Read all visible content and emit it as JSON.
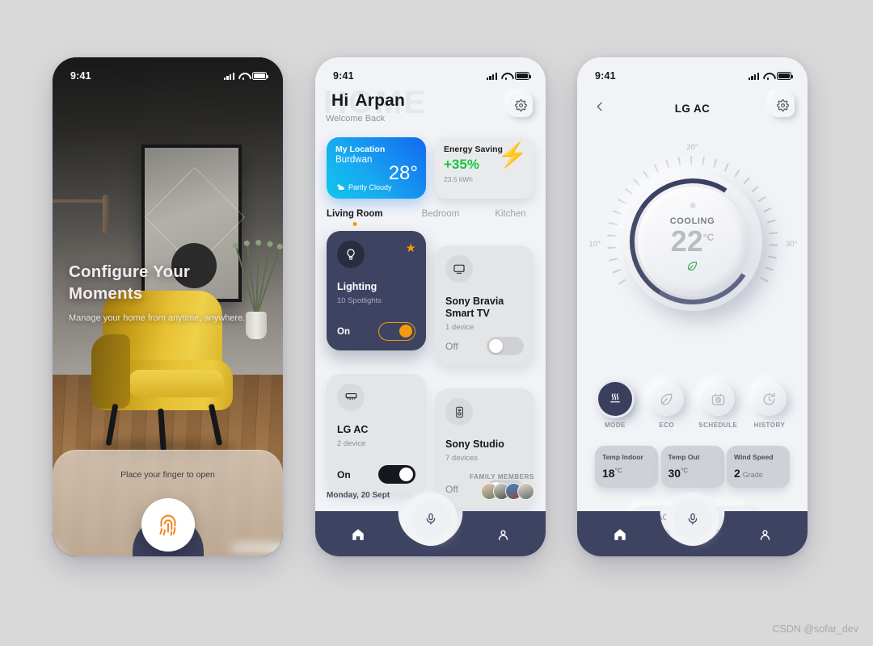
{
  "canvas": {
    "background": "#d9d9d9",
    "watermark": "CSDN @sofar_dev"
  },
  "onboarding": {
    "status": {
      "time": "9:41",
      "signal": "signal-icon",
      "wifi": "wifi-icon",
      "battery": "battery-icon"
    },
    "title": "Configure Your Moments",
    "subtitle": "Manage your home from anytime, anywhere.",
    "unlock_hint": "Place your finger to open",
    "fingerprint_icon": "fingerprint-icon"
  },
  "home": {
    "status": {
      "time": "9:41"
    },
    "watermark": "HOME",
    "greeting_prefix": "Hi",
    "greeting_name": "Arpan",
    "welcome": "Welcome Back",
    "settings_icon": "gear-icon",
    "weather": {
      "label": "My Location",
      "city": "Burdwan",
      "temperature": "28°",
      "condition": "Partly Cloudy",
      "condition_icon": "partly-cloudy-icon"
    },
    "energy": {
      "label": "Energy Saving",
      "percent": "+35%",
      "usage": "23.5 kWh",
      "icon": "lightning-bolt-icon",
      "accent": "#18c63f"
    },
    "rooms": [
      {
        "label": "Living Room",
        "active": true
      },
      {
        "label": "Bedroom",
        "active": false
      },
      {
        "label": "Kitchen",
        "active": false
      }
    ],
    "devices": [
      {
        "name": "Lighting",
        "sub": "10 Spotlights",
        "state": "On",
        "icon": "lightbulb-icon",
        "favorite": true
      },
      {
        "name": "Sony Bravia Smart TV",
        "sub": "1 device",
        "state": "Off",
        "icon": "tv-icon",
        "favorite": false
      },
      {
        "name": "LG AC",
        "sub": "2 device",
        "state": "On",
        "icon": "air-conditioner-icon",
        "favorite": false
      },
      {
        "name": "Sony Studio",
        "sub": "7 devices",
        "state": "Off",
        "icon": "speaker-icon",
        "favorite": false
      }
    ],
    "date": "Monday, 20 Sept",
    "family_label": "FAMILY MEMBERS",
    "family_count": 4,
    "nav": {
      "home_icon": "home-icon",
      "mic_icon": "microphone-icon",
      "profile_icon": "person-icon"
    }
  },
  "device_detail": {
    "status": {
      "time": "9:41"
    },
    "back_icon": "chevron-left-icon",
    "title": "LG AC",
    "settings_icon": "gear-icon",
    "dial": {
      "mode_label": "COOLING",
      "temperature": "22",
      "unit": "°C",
      "eco_icon": "leaf-icon",
      "min_label": "10°",
      "mid_label": "20°",
      "max_label": "30°"
    },
    "modes": [
      {
        "label": "MODE",
        "icon": "heat-waves-icon",
        "active": true
      },
      {
        "label": "ECO",
        "icon": "leaf-icon",
        "active": false
      },
      {
        "label": "SCHEDULE",
        "icon": "timer-camera-icon",
        "active": false
      },
      {
        "label": "HISTORY",
        "icon": "history-clock-icon",
        "active": false
      }
    ],
    "info_cards": [
      {
        "title": "Temp Indoor",
        "value": "18",
        "unit": "°C",
        "suffix": ""
      },
      {
        "title": "Temp Out",
        "value": "30",
        "unit": "°C",
        "suffix": ""
      },
      {
        "title": "Wind Speed",
        "value": "2",
        "unit": "",
        "suffix": "Grade"
      }
    ],
    "selector": {
      "value": "LG AC - LR",
      "chevron_icon": "chevron-down-icon"
    },
    "nav": {
      "home_icon": "home-icon",
      "mic_icon": "microphone-icon",
      "profile_icon": "person-icon"
    }
  }
}
